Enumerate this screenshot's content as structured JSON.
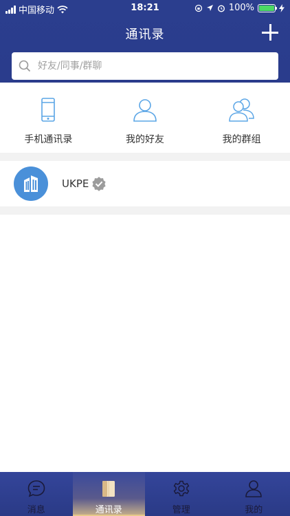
{
  "status_bar": {
    "carrier": "中国移动",
    "time": "18:21",
    "battery": "100%"
  },
  "header": {
    "title": "通讯录"
  },
  "search": {
    "placeholder": "好友/同事/群聊"
  },
  "quick_entries": [
    {
      "label": "手机通讯录",
      "icon": "phone-icon"
    },
    {
      "label": "我的好友",
      "icon": "person-icon"
    },
    {
      "label": "我的群组",
      "icon": "group-icon"
    }
  ],
  "contacts": [
    {
      "name": "UKPE",
      "icon": "building-icon",
      "verified": true
    }
  ],
  "tabbar": {
    "items": [
      {
        "label": "消息",
        "icon": "message-icon"
      },
      {
        "label": "通讯录",
        "icon": "book-icon",
        "active": true
      },
      {
        "label": "管理",
        "icon": "gear-icon"
      },
      {
        "label": "我的",
        "icon": "user-icon"
      }
    ]
  },
  "colors": {
    "header_bg": "#2b3e8e",
    "icon_blue": "#5aa5e6",
    "avatar_blue": "#4a90d9",
    "tab_active_accent": "#e7c98a",
    "battery_green": "#4cd964"
  }
}
